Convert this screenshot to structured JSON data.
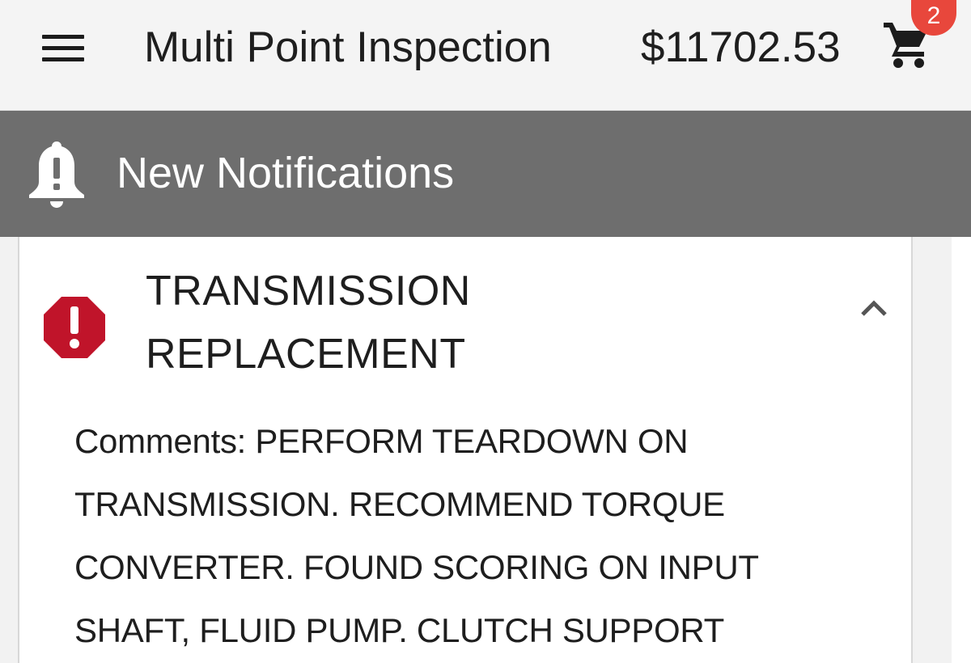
{
  "header": {
    "title": "Multi Point Inspection",
    "cart_total": "$11702.53",
    "cart_count": "2",
    "menu_icon": "hamburger-menu-icon",
    "cart_icon": "cart-icon"
  },
  "notifications": {
    "label": "New Notifications",
    "icon": "bell-alert-icon"
  },
  "inspection_item": {
    "title_line1": "TRANSMISSION",
    "title_line2": "REPLACEMENT",
    "status_icon": "critical-alert-icon",
    "status_color": "#c0142a",
    "expand_icon": "chevron-up-icon",
    "comments_lines": [
      "Comments: PERFORM TEARDOWN ON",
      "TRANSMISSION. RECOMMEND TORQUE",
      "CONVERTER. FOUND SCORING ON INPUT",
      "SHAFT, FLUID PUMP. CLUTCH SUPPORT"
    ]
  },
  "colors": {
    "topbar_bg": "#f4f4f4",
    "notification_bar_bg": "#6e6e6e",
    "badge_bg": "#e8473c",
    "card_bg": "#ffffff"
  }
}
